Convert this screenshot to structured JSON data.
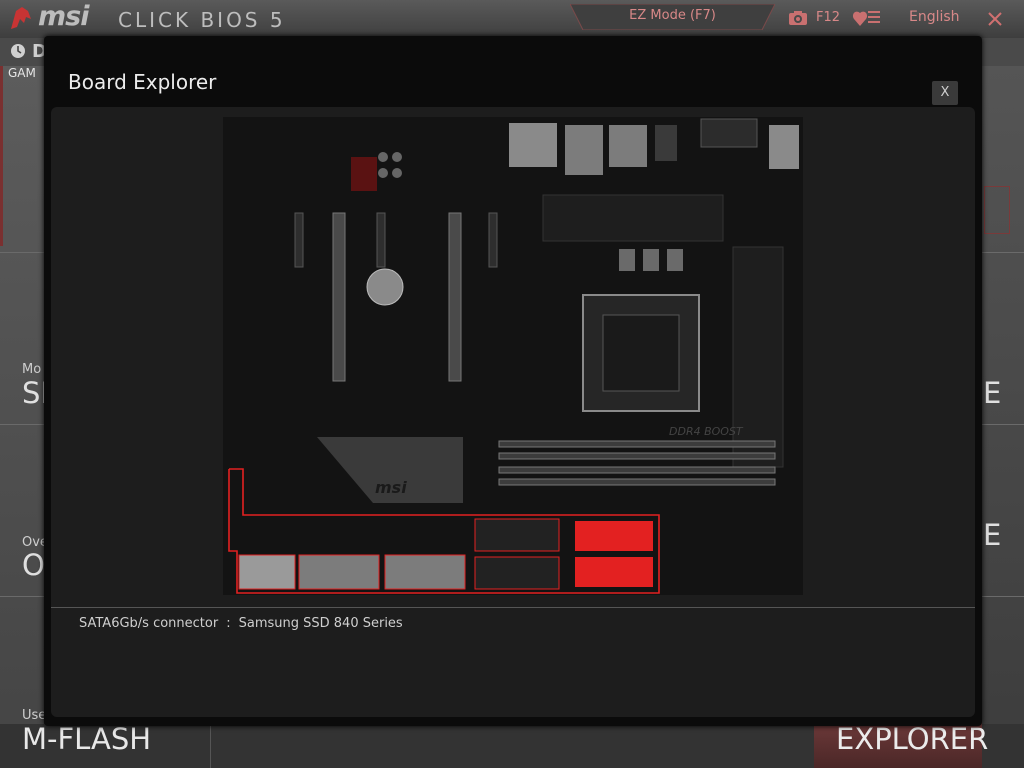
{
  "header": {
    "brand": "msi",
    "product": "CLICK BIOS 5",
    "ez_mode": "EZ Mode (F7)",
    "screenshot_key": "F12",
    "language": "English"
  },
  "background": {
    "top_letter": "D",
    "game_label": "GAM",
    "items": [
      {
        "small": "Mo",
        "big": "SI",
        "right": "E"
      },
      {
        "small": "Ove",
        "big": "O",
        "right": "E"
      }
    ],
    "mflash_small": "Use",
    "mflash_big": "M-FLASH",
    "explorer_big": "EXPLORER"
  },
  "modal": {
    "title": "Board Explorer",
    "close_label": "X",
    "info_label": "SATA6Gb/s connector",
    "info_separator": ":",
    "info_value": "Samsung SSD 840 Series",
    "board_silkscreen": "DDR4 BOOST",
    "board_logo": "msi"
  },
  "colors": {
    "accent": "#e32121",
    "accent_dim": "#d88888",
    "modal_bg": "#0b0b0b",
    "panel_bg": "#1d1d1d"
  },
  "icons": [
    "dragon-logo-icon",
    "camera-icon",
    "favorite-icon",
    "close-icon",
    "clock-icon"
  ]
}
